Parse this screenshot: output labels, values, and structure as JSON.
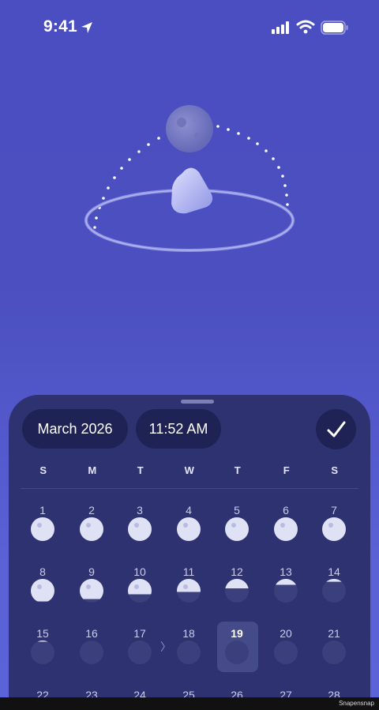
{
  "status_bar": {
    "time": "9:41",
    "icons": [
      "location-arrow-icon",
      "cellular-signal-icon",
      "wifi-icon",
      "battery-icon"
    ]
  },
  "scene": {
    "icons": [
      "moon-icon",
      "earth-gem-icon",
      "orbit-ring"
    ]
  },
  "sheet": {
    "month_label": "March 2026",
    "time_label": "11:52 AM",
    "confirm_icon": "checkmark-icon",
    "weekdays": [
      "S",
      "M",
      "T",
      "W",
      "T",
      "F",
      "S"
    ],
    "days": [
      {
        "num": "1",
        "phase": 1.0
      },
      {
        "num": "2",
        "phase": 1.0
      },
      {
        "num": "3",
        "phase": 1.0
      },
      {
        "num": "4",
        "phase": 1.0
      },
      {
        "num": "5",
        "phase": 1.0
      },
      {
        "num": "6",
        "phase": 1.0
      },
      {
        "num": "7",
        "phase": 1.0
      },
      {
        "num": "8",
        "phase": 0.95
      },
      {
        "num": "9",
        "phase": 0.85
      },
      {
        "num": "10",
        "phase": 0.65
      },
      {
        "num": "11",
        "phase": 0.55
      },
      {
        "num": "12",
        "phase": 0.4
      },
      {
        "num": "13",
        "phase": 0.25
      },
      {
        "num": "14",
        "phase": 0.12
      },
      {
        "num": "15",
        "phase": 0.05
      },
      {
        "num": "16",
        "phase": 0.0
      },
      {
        "num": "17",
        "phase": 0.0
      },
      {
        "num": "18",
        "phase": 0.0
      },
      {
        "num": "19",
        "phase": 0.0
      },
      {
        "num": "20",
        "phase": 0.0
      },
      {
        "num": "21",
        "phase": 0.0
      },
      {
        "num": "22",
        "phase": 0.0
      },
      {
        "num": "23",
        "phase": 0.0
      },
      {
        "num": "24",
        "phase": 0.0
      },
      {
        "num": "25",
        "phase": 0.0
      },
      {
        "num": "26",
        "phase": 0.0
      },
      {
        "num": "27",
        "phase": 0.0
      },
      {
        "num": "28",
        "phase": 0.0
      }
    ],
    "selected_day": "19",
    "chevron": "〉"
  },
  "footer": {
    "watermark": "Snapensnap"
  },
  "colors": {
    "accent": "#4a4ec0",
    "sheet": "#2e3270",
    "pill": "#1f2255"
  }
}
